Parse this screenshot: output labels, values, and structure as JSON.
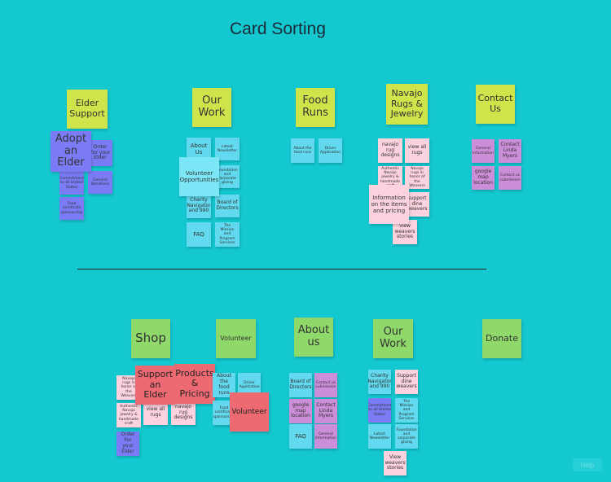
{
  "title": "Card Sorting",
  "help_label": "Help",
  "top": {
    "headers": {
      "elder_support": "Elder Support",
      "our_work": "Our Work",
      "food_runs": "Food Runs",
      "navajo": "Navajo Rugs & Jewelry",
      "contact_us": "Contact Us"
    },
    "cards": {
      "adopt_elder": "Adopt an Elder",
      "order_elder": "Order For your Elder",
      "general_donations": "General Donations",
      "commitment_united": "Commitment to all United States",
      "food_certificate": "Food certificate sponsorship",
      "about_us": "About Us",
      "latest_newsletter": "Latest Newsletter",
      "volunteer_opps": "Volunteer Opportunities",
      "foundation_giving": "Foundation and corporate giving",
      "charity_navigator": "Charity Navigator and 990",
      "board_directors": "Board of Directors",
      "faq": "FAQ",
      "mission_programs": "The Mission and Program Services",
      "about_food_runs": "About the food runs",
      "driver_application": "Driver Application",
      "navajo_rug_designs": "navajo rug designs",
      "view_all_rugs": "view all rugs",
      "authentic_jewelry": "Authentic Navajo jewelry & handmade craft",
      "navajo_rugs_honor": "Navajo rugs in honor of the Weavers",
      "information_pricing": "Information on the items and pricing",
      "support_weavers": "support dine weavers",
      "view_weavers_stories": "view weavers stories",
      "general_information": "General Information",
      "contact_linda": "Contact Linda Myers",
      "google_map": "google map location",
      "contact_submission": "Contact us submission"
    }
  },
  "bottom": {
    "headers": {
      "shop": "Shop",
      "volunteer": "Volunteer",
      "about_us": "About us",
      "our_work": "Our Work",
      "donate": "Donate"
    },
    "cards": {
      "navajo_rugs_honor": "Navajo rugs in honor of the Weavers",
      "support_elder": "Support an Elder",
      "products_pricing": "Products & Pricing",
      "authentic_jewelry": "Authentic Navajo jewelry & handmade craft",
      "view_all_rugs": "view all rugs",
      "navajo_rug_designs": "navajo rug designs",
      "order_elder": "Order For your Elder",
      "about_food_runs": "About the food runs",
      "driver_application": "Driver Application",
      "food_certificate": "Food certificate sponsorship",
      "volunteer": "Volunteer",
      "board_directors": "Board of Directors",
      "contact_submission": "Contact us submission",
      "google_map": "google map location",
      "contact_linda": "Contact Linda Myers",
      "faq": "FAQ",
      "general_information": "General Information",
      "charity_navigator": "Charity Navigator and 990",
      "support_weavers": "Support dine weavers",
      "commitment_united": "Commitment to all United States",
      "mission_programs": "The Mission and Program Services",
      "latest_newsletter": "Latest Newsletter",
      "foundation_giving": "Foundation and corporate giving",
      "view_weavers_stories": "View weavers stories"
    }
  },
  "colors": {
    "background": "#14c8d0",
    "header_green": "#8fd86a",
    "header_yellow": "#cfe34a",
    "card_cyan": "#7be6f5",
    "card_violet": "#7b7cf5",
    "card_pink": "#fbd2dd",
    "card_purple": "#cc8ed8",
    "card_red": "#ee6a73"
  }
}
